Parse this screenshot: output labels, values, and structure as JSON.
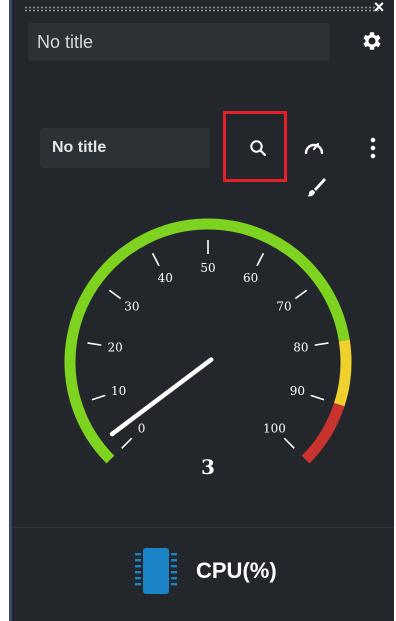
{
  "header": {
    "title_value": "No title",
    "close_label": "×"
  },
  "widget": {
    "title": "No title",
    "toolbar": {
      "search_icon": "search-icon",
      "gauge_icon": "speedometer-icon",
      "more_icon": "kebab-icon",
      "brush_icon": "paint-brush-icon"
    }
  },
  "gauge": {
    "value": 3,
    "min": 0,
    "max": 100,
    "ticks": [
      0,
      10,
      20,
      30,
      40,
      50,
      60,
      70,
      80,
      90,
      100
    ],
    "bands": [
      {
        "from": 0,
        "to": 80,
        "color": "#7ed320"
      },
      {
        "from": 80,
        "to": 90,
        "color": "#f0d02c"
      },
      {
        "from": 90,
        "to": 100,
        "color": "#c8322f"
      }
    ],
    "value_label": "3"
  },
  "footer": {
    "icon": "cpu-chip-icon",
    "label": "CPU(%)"
  },
  "colors": {
    "panel": "#23272b",
    "highlight": "#e51e2b",
    "chip": "#1a84c7"
  }
}
